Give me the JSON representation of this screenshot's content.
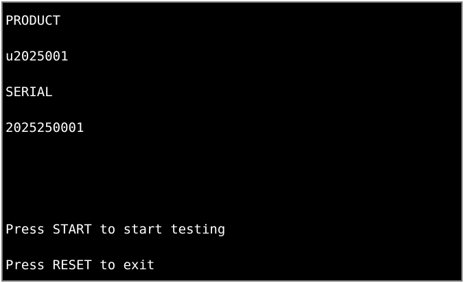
{
  "screen": {
    "product_label": "PRODUCT",
    "product_value": "u2025001",
    "serial_label": "SERIAL",
    "serial_value": "2025250001",
    "start_prompt": "Press START to start testing",
    "reset_prompt": "Press RESET to exit"
  },
  "colors": {
    "background": "#000000",
    "text": "#ffffff",
    "border": "#7a7a7a"
  }
}
